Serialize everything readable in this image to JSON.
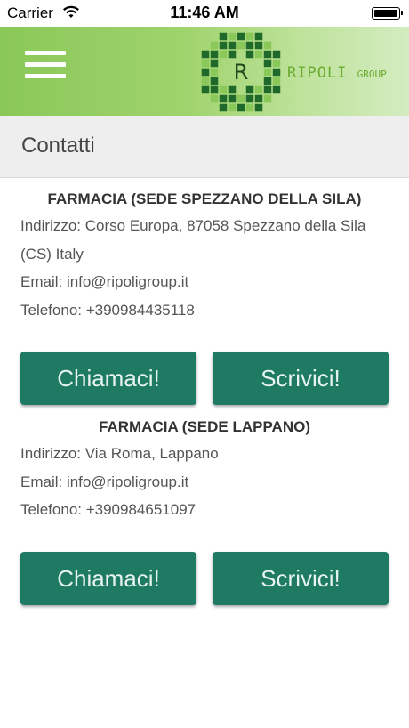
{
  "status_bar": {
    "carrier": "Carrier",
    "time": "11:46 AM"
  },
  "header": {
    "logo_text": "RIPOLI",
    "logo_subtext": "GROUP",
    "brand_colors": {
      "dark_green": "#1f6a2a",
      "light_green": "#8ac859"
    }
  },
  "page": {
    "title": "Contatti"
  },
  "locations": [
    {
      "name": "FARMACIA (SEDE SPEZZANO DELLA SILA)",
      "address_line1": "Indirizzo: Corso Europa, 87058 Spezzano della Sila",
      "address_line2": "(CS) Italy",
      "email": "Email: info@ripoligroup.it",
      "phone": "Telefono: +390984435118",
      "call_label": "Chiamaci!",
      "write_label": "Scrivici!"
    },
    {
      "name": "FARMACIA (SEDE LAPPANO)",
      "address_line1": "Indirizzo: Via Roma, Lappano",
      "email": "Email: info@ripoligroup.it",
      "phone": "Telefono: +390984651097",
      "call_label": "Chiamaci!",
      "write_label": "Scrivici!"
    }
  ],
  "colors": {
    "button_bg": "#1f7a63",
    "header_green": "#8ac859"
  }
}
